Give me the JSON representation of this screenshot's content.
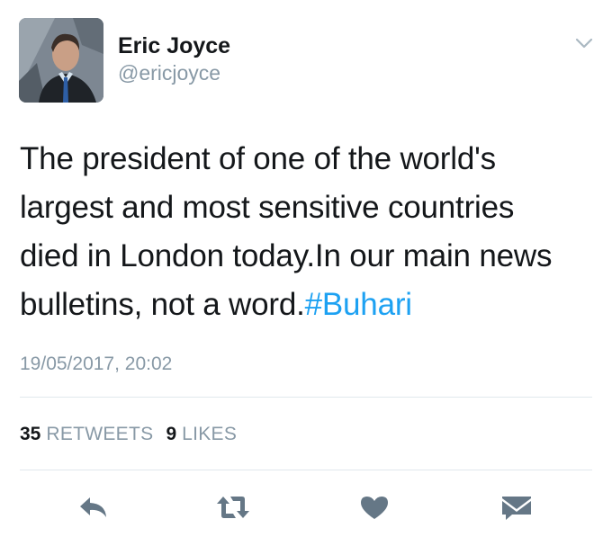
{
  "author": {
    "display_name": "Eric Joyce",
    "screen_name": "@ericjoyce"
  },
  "tweet": {
    "lines": [
      "The president of one of the world's",
      "largest and most sensitive countries",
      "died in London today.In our main news",
      "bulletins, not a word."
    ],
    "hashtag": "#Buhari",
    "timestamp": "19/05/2017, 20:02"
  },
  "stats": {
    "retweets_count": "35",
    "retweets_label": "RETWEETS",
    "likes_count": "9",
    "likes_label": "LIKES"
  },
  "actions": {
    "reply_icon": "reply-icon",
    "retweet_icon": "retweet-icon",
    "like_icon": "heart-icon",
    "dm_icon": "envelope-icon"
  },
  "colors": {
    "text": "#14171a",
    "secondary": "#8899a6",
    "link": "#1da1f2",
    "divider": "#e1e8ed",
    "icon": "#657786"
  }
}
